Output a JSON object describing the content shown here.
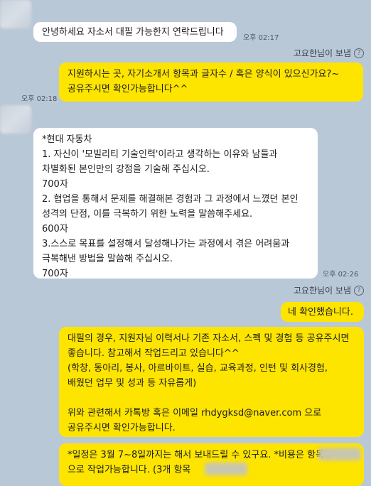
{
  "messages": [
    {
      "text": "안녕하세요 자소서 대필 가능한지 연락드립니다",
      "time": "오후 02:17"
    },
    {
      "reply_label": "고요한님이 보냄",
      "text": "지원하시는 곳, 자기소개서 항목과 글자수 / 혹은 양식이 있으신가요?~\n공유주시면 확인가능합니다^^",
      "time": "오후 02:18"
    },
    {
      "text": "*현대 자동차\n1. 자신이 '모빌리티 기술인력'이라고 생각하는 이유와 남들과 차별화된 본인만의 강점을 기술해 주십시오.\n700자\n2. 협업을 통해서 문제를 해결해본 경험과 그 과정에서 느꼈던 본인 성격의 단점, 이를 극복하기 위한 노력을 말씀해주세요.\n600자\n3.스스로 목표를 설정해서 달성해나가는 과정에서 겪은 어려움과 극복해낸 방법을 말씀해 주십시오.\n700자",
      "time": "오후 02:26"
    },
    {
      "reply_label": "고요한님이 보냄",
      "text": "네 확인했습니다."
    },
    {
      "text": "대필의 경우, 지원자님 이력서나 기존 자소서, 스펙 및 경험 등 공유주시면 좋습니다. 참고해서 작업드리고 있습니다^^\n(학창, 동아리, 봉사, 아르바이트, 실습, 교육과정, 인턴 및 회사경험, 배웠던 업무 및 성과 등 자유롭게)\n\n위와 관련해서 카톡방 혹은 이메일 rhdygksd@naver.com 으로 공유주시면 확인가능합니다."
    },
    {
      "text": "*일정은 3월 7~8일까지는 해서 보내드릴 수 있구요. *비용은 항목당\n으로 작업가능합니다. (3개 항목"
    }
  ]
}
